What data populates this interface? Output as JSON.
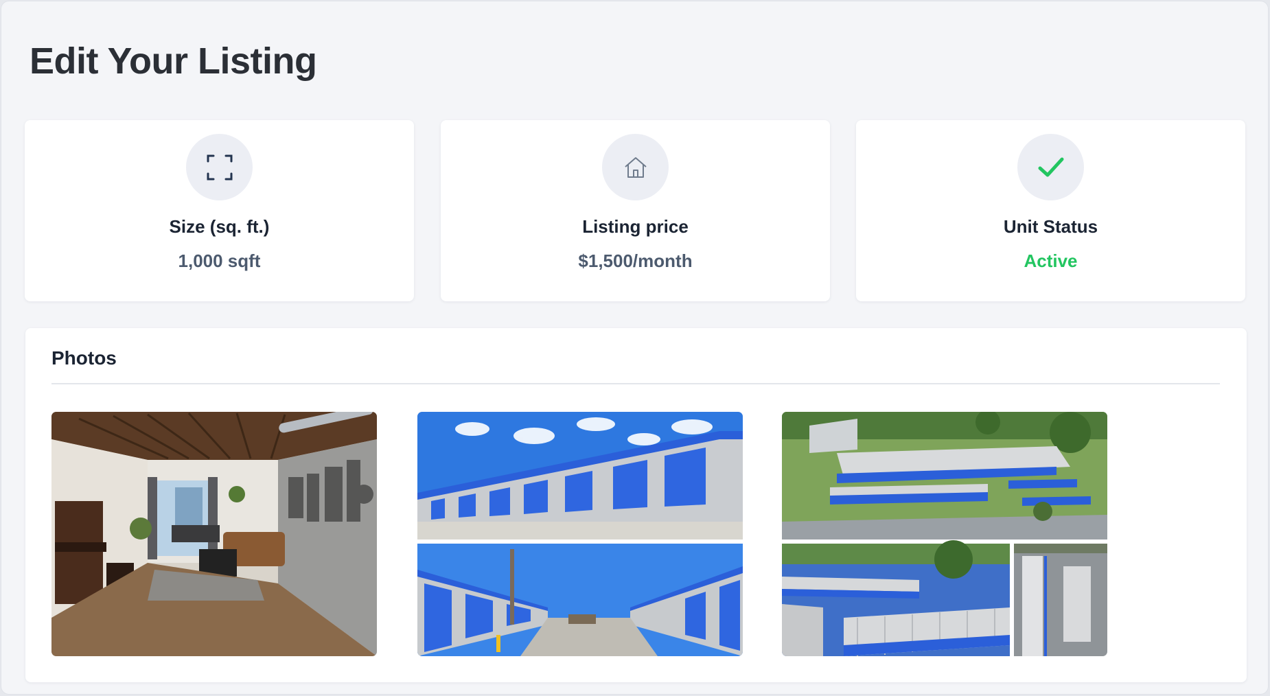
{
  "page": {
    "title": "Edit Your Listing"
  },
  "stats": [
    {
      "label": "Size (sq. ft.)",
      "value": "1,000 sqft",
      "icon": "expand-icon"
    },
    {
      "label": "Listing price",
      "value": "$1,500/month",
      "icon": "house-icon"
    },
    {
      "label": "Unit Status",
      "value": "Active",
      "icon": "check-icon",
      "value_color": "#22c560"
    }
  ],
  "photos": {
    "title": "Photos",
    "items": [
      {
        "subject": "loft-interior-photo"
      },
      {
        "subject": "storage-units-collage-photo"
      },
      {
        "subject": "aerial-storage-facility-collage-photo"
      }
    ]
  },
  "colors": {
    "accent_blue": "#2b5fd9",
    "status_green": "#22c560",
    "title_text": "#2b2f36"
  }
}
